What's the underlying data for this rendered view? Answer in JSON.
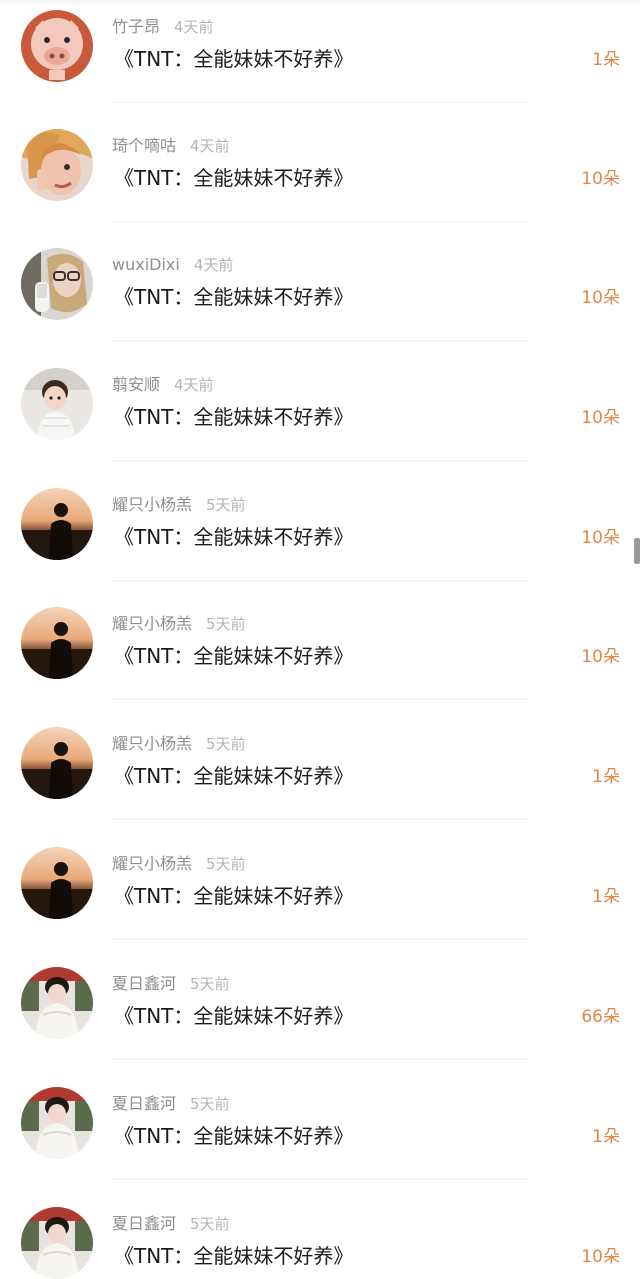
{
  "records": [
    {
      "username": "竹子昂",
      "time": "4天前",
      "gift": "《TNT：全能妹妹不好养》",
      "count": "1朵",
      "avatar": "pig-illustration-avatar"
    },
    {
      "username": "琦个嘀咕",
      "time": "4天前",
      "gift": "《TNT：全能妹妹不好养》",
      "count": "10朵",
      "avatar": "blonde-girl-avatar"
    },
    {
      "username": "wuxiDixi",
      "time": "4天前",
      "gift": "《TNT：全能妹妹不好养》",
      "count": "10朵",
      "avatar": "glasses-woman-avatar"
    },
    {
      "username": "翦安顺",
      "time": "4天前",
      "gift": "《TNT：全能妹妹不好养》",
      "count": "10朵",
      "avatar": "toddler-avatar"
    },
    {
      "username": "耀只小杨羔",
      "time": "5天前",
      "gift": "《TNT：全能妹妹不好养》",
      "count": "10朵",
      "avatar": "sunset-silhouette-avatar"
    },
    {
      "username": "耀只小杨羔",
      "time": "5天前",
      "gift": "《TNT：全能妹妹不好养》",
      "count": "10朵",
      "avatar": "sunset-silhouette-avatar"
    },
    {
      "username": "耀只小杨羔",
      "time": "5天前",
      "gift": "《TNT：全能妹妹不好养》",
      "count": "1朵",
      "avatar": "sunset-silhouette-avatar"
    },
    {
      "username": "耀只小杨羔",
      "time": "5天前",
      "gift": "《TNT：全能妹妹不好养》",
      "count": "1朵",
      "avatar": "sunset-silhouette-avatar"
    },
    {
      "username": "夏日鑫河",
      "time": "5天前",
      "gift": "《TNT：全能妹妹不好养》",
      "count": "66朵",
      "avatar": "costume-girl-avatar"
    },
    {
      "username": "夏日鑫河",
      "time": "5天前",
      "gift": "《TNT：全能妹妹不好养》",
      "count": "1朵",
      "avatar": "costume-girl-avatar"
    },
    {
      "username": "夏日鑫河",
      "time": "5天前",
      "gift": "《TNT：全能妹妹不好养》",
      "count": "10朵",
      "avatar": "costume-girl-avatar"
    }
  ],
  "colors": {
    "count_accent": "#e0884a",
    "username": "#8f8f8f",
    "time": "#b4b4b4",
    "title": "#1c1c1c"
  }
}
